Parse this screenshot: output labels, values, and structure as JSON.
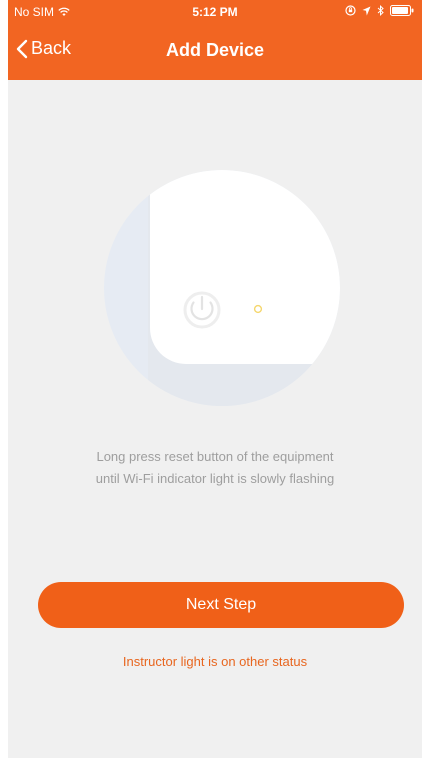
{
  "status_bar": {
    "carrier": "No SIM",
    "time": "5:12 PM",
    "icons": [
      "wifi-icon",
      "orientation-lock-icon",
      "location-arrow-icon",
      "bluetooth-icon",
      "battery-icon"
    ]
  },
  "nav": {
    "back_label": "Back",
    "title": "Add Device"
  },
  "instruction": {
    "line1": "Long press reset button of the equipment",
    "line2": "until Wi-Fi indicator light is slowly flashing"
  },
  "next_button": {
    "label": "Next Step"
  },
  "other_status_link": {
    "label": "Instructor light is on other status"
  },
  "colors": {
    "accent": "#f26522",
    "background": "#f0f0f0",
    "illustration_circle": "#e8edf5",
    "wifi_indicator": "#f5d76e"
  }
}
